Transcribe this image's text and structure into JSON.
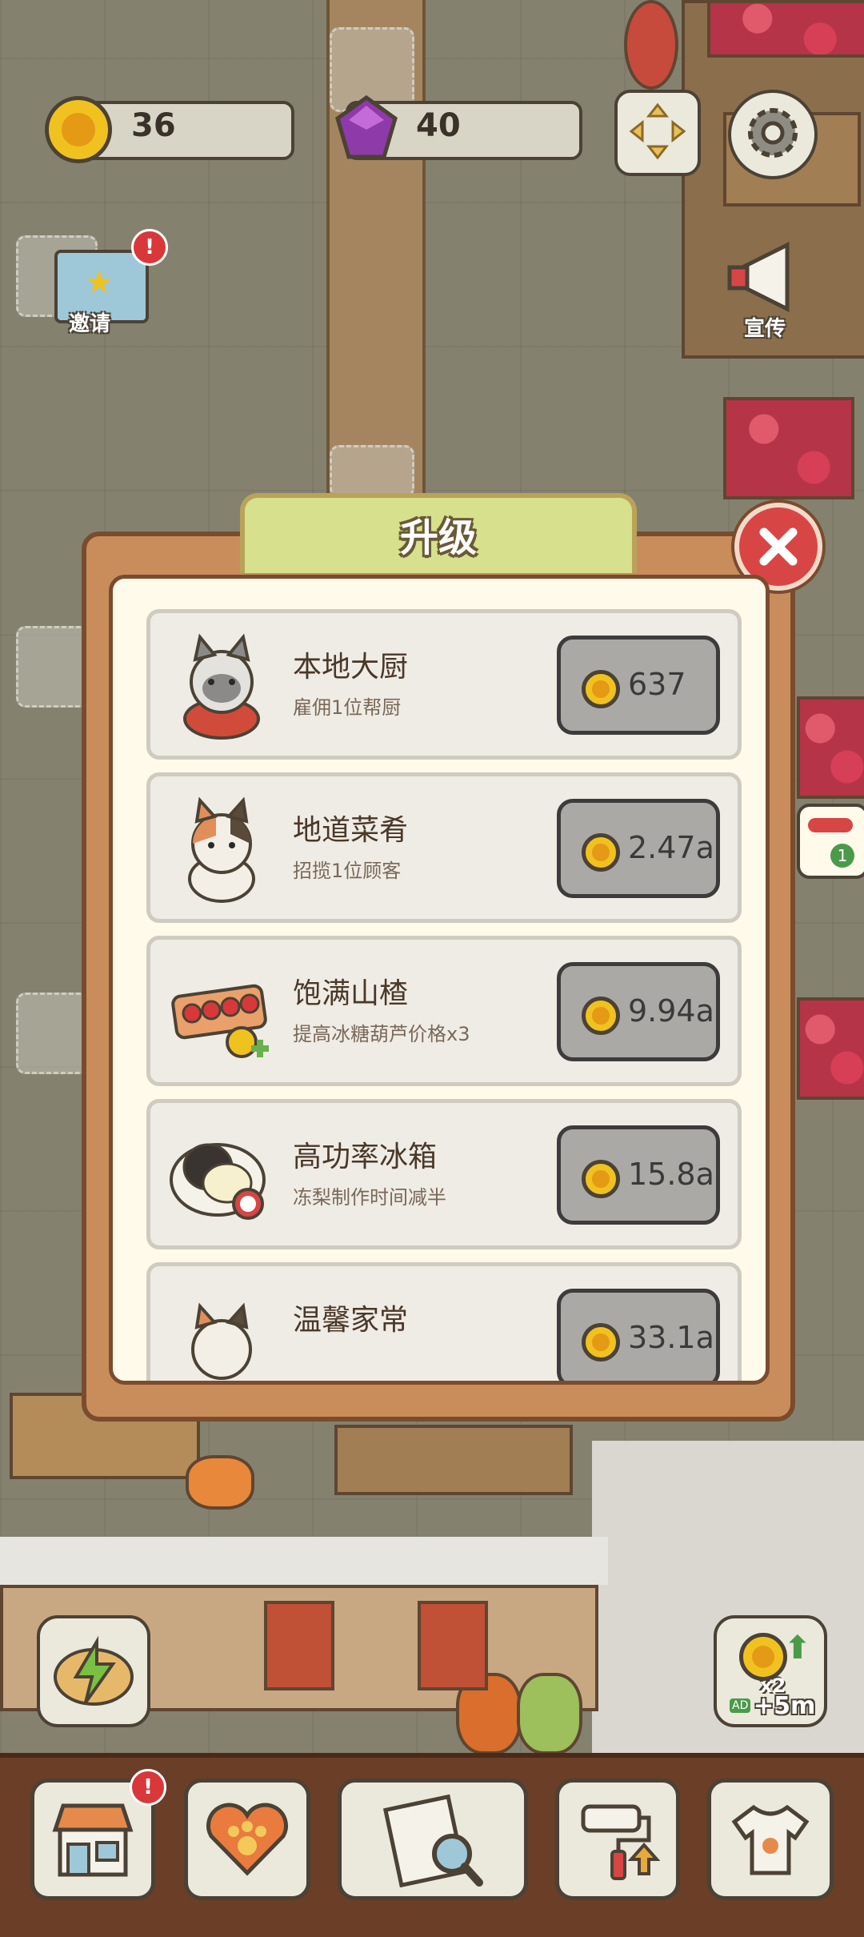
{
  "topbar": {
    "coins": "36",
    "gems": "40",
    "move_icon": "arrows-move-icon",
    "settings_icon": "gear-icon"
  },
  "side": {
    "invite_label": "邀请",
    "invite_badge": "!",
    "promote_label": "宣传",
    "order_count": "1"
  },
  "dialog": {
    "title": "升级",
    "items": [
      {
        "title": "本地大厨",
        "desc": "雇佣1位帮厨",
        "price": "637",
        "icon": "chef-cat-icon"
      },
      {
        "title": "地道菜肴",
        "desc": "招揽1位顾客",
        "price": "2.47a",
        "icon": "calico-cat-icon"
      },
      {
        "title": "饱满山楂",
        "desc": "提高冰糖葫芦价格x3",
        "price": "9.94a",
        "icon": "hawthorn-skewer-icon"
      },
      {
        "title": "高功率冰箱",
        "desc": "冻梨制作时间减半",
        "price": "15.8a",
        "icon": "frozen-pear-icon"
      },
      {
        "title": "温馨家常",
        "desc": "",
        "price": "33.1a",
        "icon": "calico-cat-icon"
      }
    ]
  },
  "boost": {
    "multiplier": "x2",
    "ad_label": "AD",
    "duration": "+5m"
  },
  "bottom_nav": {
    "shop_badge": "!",
    "items": [
      "shop-icon",
      "heart-paw-icon",
      "newspaper-search-icon",
      "paint-roller-icon",
      "tshirt-icon"
    ]
  },
  "colors": {
    "panel": "#c98d5c",
    "title_tab": "#d7e08c",
    "close": "#d84545",
    "coin": "#f0c21f",
    "gem": "#8e3aa8"
  }
}
